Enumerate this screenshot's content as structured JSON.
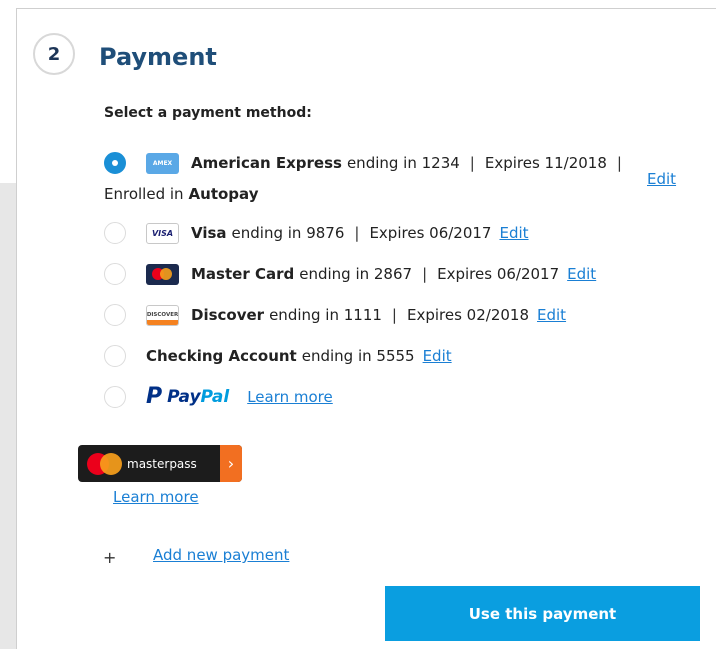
{
  "step": {
    "number": "2",
    "title": "Payment"
  },
  "subtitle": "Select a payment method:",
  "methods": [
    {
      "brand": "American Express",
      "ending_text": "ending in 1234",
      "expires": "Expires 11/2018",
      "enrolled_prefix": "Enrolled in",
      "enrolled_value": "Autopay",
      "edit": "Edit",
      "icon": "amex-card-icon",
      "icon_text": "AMEX",
      "selected": true
    },
    {
      "brand": "Visa",
      "ending_text": "ending in 9876",
      "expires": "Expires 06/2017",
      "edit": "Edit",
      "icon": "visa-card-icon",
      "icon_text": "VISA",
      "selected": false
    },
    {
      "brand": "Master Card",
      "ending_text": "ending in 2867",
      "expires": "Expires 06/2017",
      "edit": "Edit",
      "icon": "mastercard-icon",
      "selected": false
    },
    {
      "brand": "Discover",
      "ending_text": "ending in 1111",
      "expires": "Expires 02/2018",
      "edit": "Edit",
      "icon": "discover-card-icon",
      "icon_text": "DISCOVER",
      "selected": false
    },
    {
      "brand": "Checking Account",
      "ending_text": "ending in 5555",
      "edit": "Edit",
      "selected": false
    },
    {
      "brand_pay": "Pay",
      "brand_pal": "Pal",
      "logo_p": "P",
      "learn_more": "Learn more",
      "icon": "paypal-logo-icon",
      "selected": false
    }
  ],
  "masterpass": {
    "label": "masterpass",
    "arrow": "›",
    "learn_more": "Learn more"
  },
  "add_payment": {
    "plus": "+",
    "label": "Add new payment"
  },
  "submit_label": "Use this payment",
  "colors": {
    "accent": "#0a9ee0",
    "link": "#1a7fd4",
    "title": "#1f4e79"
  }
}
